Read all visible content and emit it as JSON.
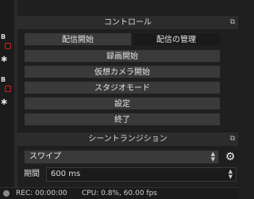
{
  "controls": {
    "title": "コントロール",
    "start_streaming": "配信開始",
    "manage_broadcast": "配信の管理",
    "start_recording": "録画開始",
    "start_virtual_camera": "仮想カメラ開始",
    "studio_mode": "スタジオモード",
    "settings": "設定",
    "exit": "終了"
  },
  "scene_transitions": {
    "title": "シーントランジション",
    "transition_selected": "スワイプ",
    "duration_label": "期間",
    "duration_value": "600 ms"
  },
  "status_bar": {
    "rec": "REC: 00:00:00",
    "cpu": "CPU: 0.8%, 60.00 fps"
  },
  "left_strip": {
    "tag1": "B",
    "tag2": "B"
  }
}
